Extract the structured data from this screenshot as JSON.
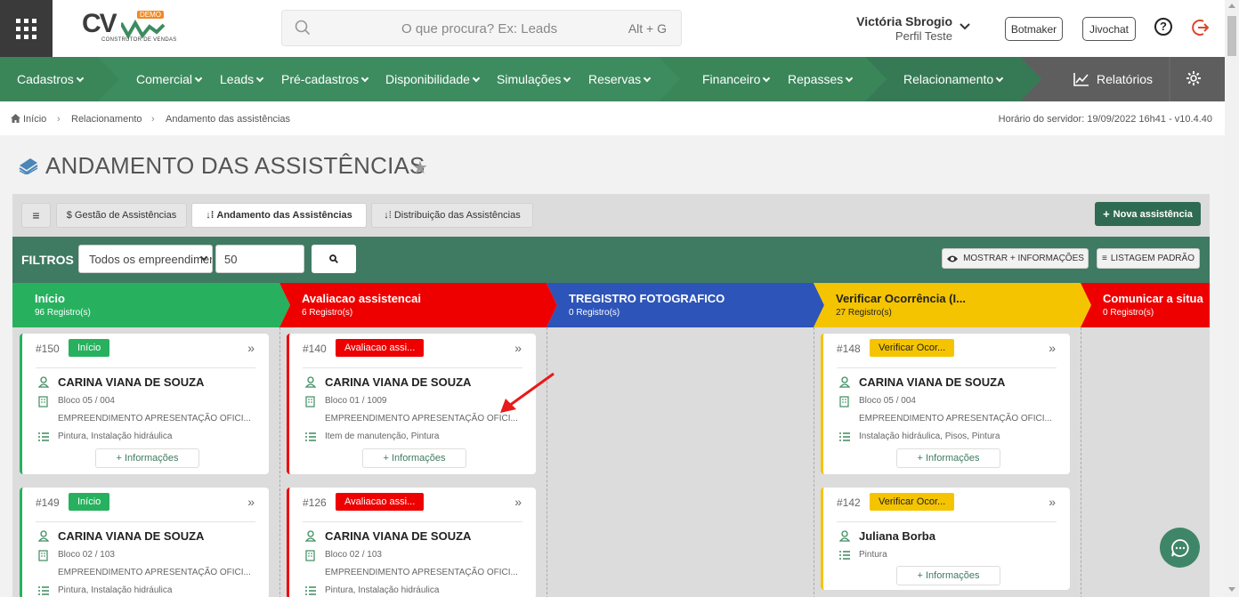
{
  "header": {
    "logo_text": "CV",
    "logo_badge": "DEMO",
    "logo_subtitle": "CONSTRUTOR DE VENDAS",
    "search_placeholder": "O que procura? Ex: Leads",
    "search_shortcut": "Alt + G",
    "user_name": "Victória Sbrogio",
    "user_profile": "Perfil Teste",
    "btn_botmaker": "Botmaker",
    "btn_jivochat": "Jivochat",
    "help": "?"
  },
  "nav": {
    "items": [
      "Cadastros",
      "Comercial",
      "Leads",
      "Pré-cadastros",
      "Disponibilidade",
      "Simulações",
      "Reservas",
      "Financeiro",
      "Repasses",
      "Relacionamento"
    ],
    "reports": "Relatórios"
  },
  "breadcrumb": {
    "items": [
      "Início",
      "Relacionamento",
      "Andamento das assistências"
    ],
    "server_time": "Horário do servidor: 19/09/2022 16h41 - v10.4.40"
  },
  "page": {
    "title": "ANDAMENTO DAS ASSISTÊNCIAS",
    "tabs": [
      "$ Gestão de Assistências",
      "Andamento das Assistências",
      "Distribuição das Assistências"
    ],
    "new_button": "Nova assistência",
    "menu_icon": "≡"
  },
  "filters": {
    "label": "FILTROS",
    "select_value": "Todos os empreendimentos",
    "limit_value": "50",
    "show_more": "MOSTRAR + INFORMAÇÕES",
    "default_list": "LISTAGEM PADRÃO"
  },
  "stages": [
    {
      "name": "Início",
      "count": "96 Registro(s)",
      "color": "#27b15f"
    },
    {
      "name": "Avaliacao assistencai",
      "count": "6 Registro(s)",
      "color": "#ee0000"
    },
    {
      "name": "TREGISTRO FOTOGRAFICO",
      "count": "0 Registro(s)",
      "color": "#2d54b8"
    },
    {
      "name": "Verificar Ocorrência (I...",
      "count": "27 Registro(s)",
      "color": "#f5c400"
    },
    {
      "name": "Comunicar a situa",
      "count": "0 Registro(s)",
      "color": "#ee0000"
    }
  ],
  "cards": {
    "col0": [
      {
        "id": "#150",
        "badge": "Início",
        "name": "CARINA VIANA DE SOUZA",
        "unit": "Bloco 05 / 004",
        "project": "EMPREENDIMENTO APRESENTAÇÃO OFICI...",
        "items": "Pintura, Instalação hidráulica",
        "more": "+ Informações"
      },
      {
        "id": "#149",
        "badge": "Início",
        "name": "CARINA VIANA DE SOUZA",
        "unit": "Bloco 02 / 103",
        "project": "EMPREENDIMENTO APRESENTAÇÃO OFICI...",
        "items": "Pintura, Instalação hidráulica"
      }
    ],
    "col1": [
      {
        "id": "#140",
        "badge": "Avaliacao assi...",
        "name": "CARINA VIANA DE SOUZA",
        "unit": "Bloco 01 / 1009",
        "project": "EMPREENDIMENTO APRESENTAÇÃO OFICI...",
        "items": "Item de manutenção, Pintura",
        "more": "+ Informações"
      },
      {
        "id": "#126",
        "badge": "Avaliacao assi...",
        "name": "CARINA VIANA DE SOUZA",
        "unit": "Bloco 02 / 103",
        "project": "EMPREENDIMENTO APRESENTAÇÃO OFICI...",
        "items": "Pintura, Instalação hidráulica"
      }
    ],
    "col3": [
      {
        "id": "#148",
        "badge": "Verificar Ocor...",
        "name": "CARINA VIANA DE SOUZA",
        "unit": "Bloco 05 / 004",
        "project": "EMPREENDIMENTO APRESENTAÇÃO OFICI...",
        "items": "Instalação hidráulica, Pisos, Pintura",
        "more": "+ Informações"
      },
      {
        "id": "#142",
        "badge": "Verificar Ocor...",
        "name": "Juliana Borba",
        "items": "Pintura",
        "more": "+ Informações"
      }
    ]
  }
}
